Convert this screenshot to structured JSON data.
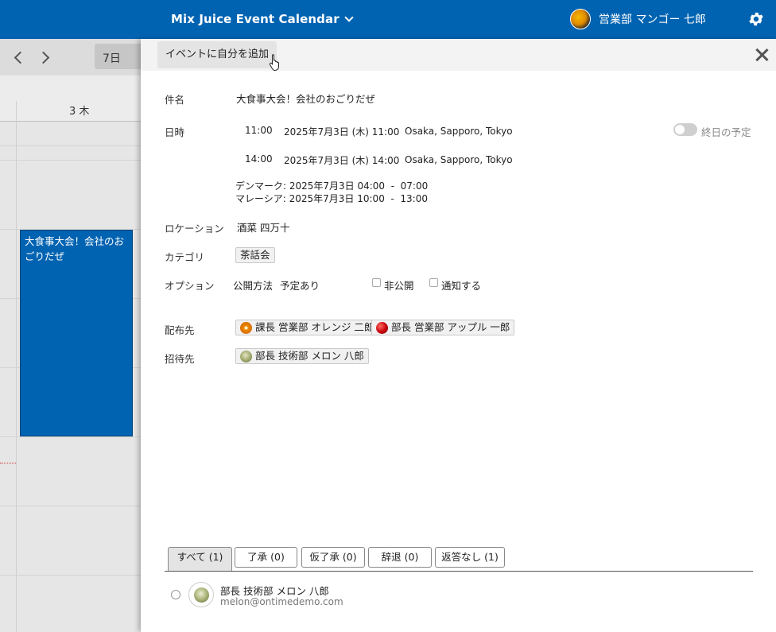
{
  "app": {
    "title": "Mix Juice Event Calendar",
    "user_name": "営業部 マンゴー 七郎"
  },
  "calendar": {
    "view_label": "7日",
    "day_label": "3 木",
    "event_title": "大食事大会！会社のおごりだぜ"
  },
  "panel": {
    "join_button": "イベントに自分を追加",
    "fields": {
      "title_label": "件名",
      "title_value": "大食事大会！会社のおごりだぜ",
      "datetime_label": "日時",
      "start_time": "11:00",
      "start_date": "2025年7月3日 (木) 11:00",
      "start_tz": "Osaka, Sapporo, Tokyo",
      "end_time": "14:00",
      "end_date": "2025年7月3日 (木) 14:00",
      "end_tz": "Osaka, Sapporo, Tokyo",
      "tz_line1": "デンマーク: 2025年7月3日 04:00  -  07:00",
      "tz_line2": "マレーシア: 2025年7月3日 10:00  -  13:00",
      "allday_label": "終日の予定",
      "location_label": "ロケーション",
      "location_value": "酒菜 四万十",
      "category_label": "カテゴリ",
      "category_value": "茶話会",
      "options_label": "オプション",
      "publish_label": "公開方法",
      "publish_value": "予定あり",
      "private_label": "非公開",
      "notify_label": "通知する",
      "distribution_label": "配布先",
      "distribution": [
        "課長 営業部 オレンジ 二郎",
        "部長 営業部 アップル 一郎"
      ],
      "invite_label": "招待先",
      "invitees": [
        "部長 技術部 メロン 八郎"
      ]
    },
    "tabs": [
      "すべて (1)",
      "了承 (0)",
      "仮了承 (0)",
      "辞退 (0)",
      "返答なし (1)"
    ],
    "attendee": {
      "name": "部長 技術部 メロン 八郎",
      "email": "melon@ontimedemo.com"
    }
  },
  "colors": {
    "primary": "#0063b1"
  }
}
